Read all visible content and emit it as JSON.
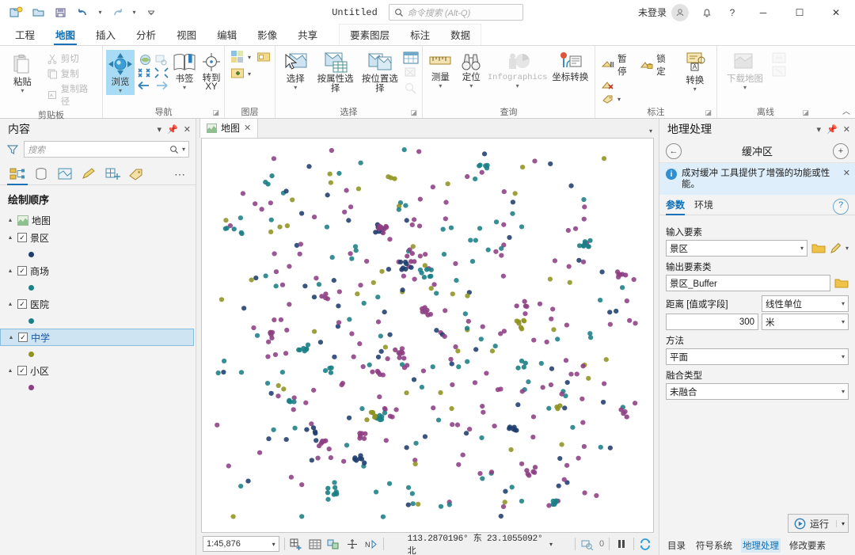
{
  "titlebar": {
    "quick_access": [
      {
        "name": "new-project-icon",
        "label": "新建工程"
      },
      {
        "name": "open-project-icon",
        "label": "打开工程"
      },
      {
        "name": "save-project-icon",
        "label": "保存工程"
      },
      {
        "name": "undo-icon",
        "label": "撤销"
      },
      {
        "name": "redo-icon",
        "label": "重做"
      },
      {
        "name": "customize-qat-icon",
        "label": "自定义快速访问工具栏"
      }
    ],
    "document_title": "Untitled",
    "search_placeholder": "命令搜索 (Alt-Q)",
    "signin_label": "未登录",
    "minimize": "─",
    "maximize": "☐",
    "close": "✕",
    "help": "?"
  },
  "ribbon": {
    "tabs": [
      {
        "label": "工程",
        "active": false
      },
      {
        "label": "地图",
        "active": true
      },
      {
        "label": "插入",
        "active": false
      },
      {
        "label": "分析",
        "active": false
      },
      {
        "label": "视图",
        "active": false
      },
      {
        "label": "编辑",
        "active": false
      },
      {
        "label": "影像",
        "active": false
      },
      {
        "label": "共享",
        "active": false
      }
    ],
    "context_tabs": [
      {
        "label": "要素图层"
      },
      {
        "label": "标注"
      },
      {
        "label": "数据"
      }
    ],
    "groups": [
      {
        "name": "clipboard",
        "label": "剪贴板",
        "big": [
          {
            "label": "粘贴",
            "caret": true
          }
        ],
        "small": [
          {
            "label": "剪切",
            "disabled": true
          },
          {
            "label": "复制",
            "disabled": true
          },
          {
            "label": "复制路径",
            "disabled": true
          }
        ]
      },
      {
        "name": "navigate",
        "label": "导航",
        "big": [
          {
            "label": "浏览",
            "caret": true,
            "selected": true
          },
          {
            "label": "书签",
            "caret": true
          },
          {
            "label": "转到XY",
            "caret": false
          }
        ]
      },
      {
        "name": "layer",
        "label": "图层",
        "small": []
      },
      {
        "name": "selection",
        "label": "选择",
        "big": [
          {
            "label": "选择",
            "caret": true
          },
          {
            "label": "按属性选择",
            "caret": false
          },
          {
            "label": "按位置选择",
            "caret": false
          }
        ]
      },
      {
        "name": "inquiry",
        "label": "查询",
        "big": [
          {
            "label": "测量",
            "caret": true
          },
          {
            "label": "定位",
            "caret": true
          },
          {
            "label": "Infographics",
            "caret": true,
            "disabled": true
          },
          {
            "label": "坐标转换",
            "caret": false
          }
        ]
      },
      {
        "name": "labeling",
        "label": "标注",
        "small": [
          {
            "label": "暂停"
          },
          {
            "label": "锁定"
          }
        ],
        "big": [
          {
            "label": "转换",
            "caret": true
          }
        ]
      },
      {
        "name": "offline",
        "label": "离线",
        "big": [
          {
            "label": "下载地图",
            "caret": true,
            "disabled": true
          }
        ]
      }
    ],
    "labeling_pause": "暂停",
    "labeling_lock": "锁定"
  },
  "contents": {
    "title": "内容",
    "search_placeholder": "搜索",
    "tabs": [
      {
        "name": "list-by-drawing-order",
        "active": true
      },
      {
        "name": "list-by-data-source",
        "active": false
      },
      {
        "name": "list-by-selection",
        "active": false
      },
      {
        "name": "list-by-editing",
        "active": false
      },
      {
        "name": "list-by-snapping",
        "active": false
      },
      {
        "name": "list-by-labeling",
        "active": false
      }
    ],
    "more_label": "⋯",
    "section_title": "绘制顺序",
    "map_node": "地图",
    "layers": [
      {
        "label": "景区",
        "checked": true,
        "color": "#1f3d6e",
        "selected": false
      },
      {
        "label": "商场",
        "checked": true,
        "color": "#1b7f86",
        "selected": false
      },
      {
        "label": "医院",
        "checked": true,
        "color": "#1b7f86",
        "selected": false
      },
      {
        "label": "中学",
        "checked": true,
        "color": "#8f9421",
        "selected": true
      },
      {
        "label": "小区",
        "checked": true,
        "color": "#8e3f84",
        "selected": false
      }
    ]
  },
  "map": {
    "tab_label": "地图",
    "tab_close": "✕",
    "scale": "1:45,876",
    "coordinates": "113.2870196° 东 23.1055092° 北",
    "selection_count": "0",
    "status_icons": [
      {
        "name": "map-scale-selector"
      },
      {
        "name": "add-data-grid-icon"
      },
      {
        "name": "attribute-table-icon"
      },
      {
        "name": "selection-tool-icon"
      },
      {
        "name": "measure-pin-icon"
      },
      {
        "name": "north-arrow-icon"
      },
      {
        "name": "clear-selection-icon"
      },
      {
        "name": "pause-drawing-icon"
      },
      {
        "name": "refresh-icon"
      }
    ]
  },
  "geoprocessing": {
    "title": "地理处理",
    "back_icon": "←",
    "add_icon": "+",
    "tool_name": "缓冲区",
    "message": "成对缓冲 工具提供了增强的功能或性能。",
    "message_close": "✕",
    "tabs": [
      {
        "label": "参数",
        "active": true
      },
      {
        "label": "环境",
        "active": false
      }
    ],
    "help_icon": "?",
    "fields": [
      {
        "label": "输入要素",
        "value": "景区",
        "type": "combo-with-buttons"
      },
      {
        "label": "输出要素类",
        "value": "景区_Buffer",
        "type": "text-with-browse"
      },
      {
        "label": "距离 [值或字段]",
        "value": "300",
        "unit_type": "线性单位",
        "unit": "米",
        "type": "distance"
      },
      {
        "label": "方法",
        "value": "平面",
        "type": "combo"
      },
      {
        "label": "融合类型",
        "value": "未融合",
        "type": "combo"
      }
    ],
    "run_label": "运行",
    "bottom_tabs": [
      {
        "label": "目录",
        "active": false
      },
      {
        "label": "符号系统",
        "active": false
      },
      {
        "label": "地理处理",
        "active": true
      },
      {
        "label": "修改要素",
        "active": false
      }
    ]
  },
  "colors": {
    "accent": "#1c72b8",
    "selected_tab": "#0f6fb5",
    "selected_row": "#cfe4f2",
    "info_bg": "#deeefa",
    "point_purple": "#8e3f84",
    "point_teal": "#1b7f86",
    "point_olive": "#8f9421",
    "point_navy": "#1f3d6e"
  }
}
